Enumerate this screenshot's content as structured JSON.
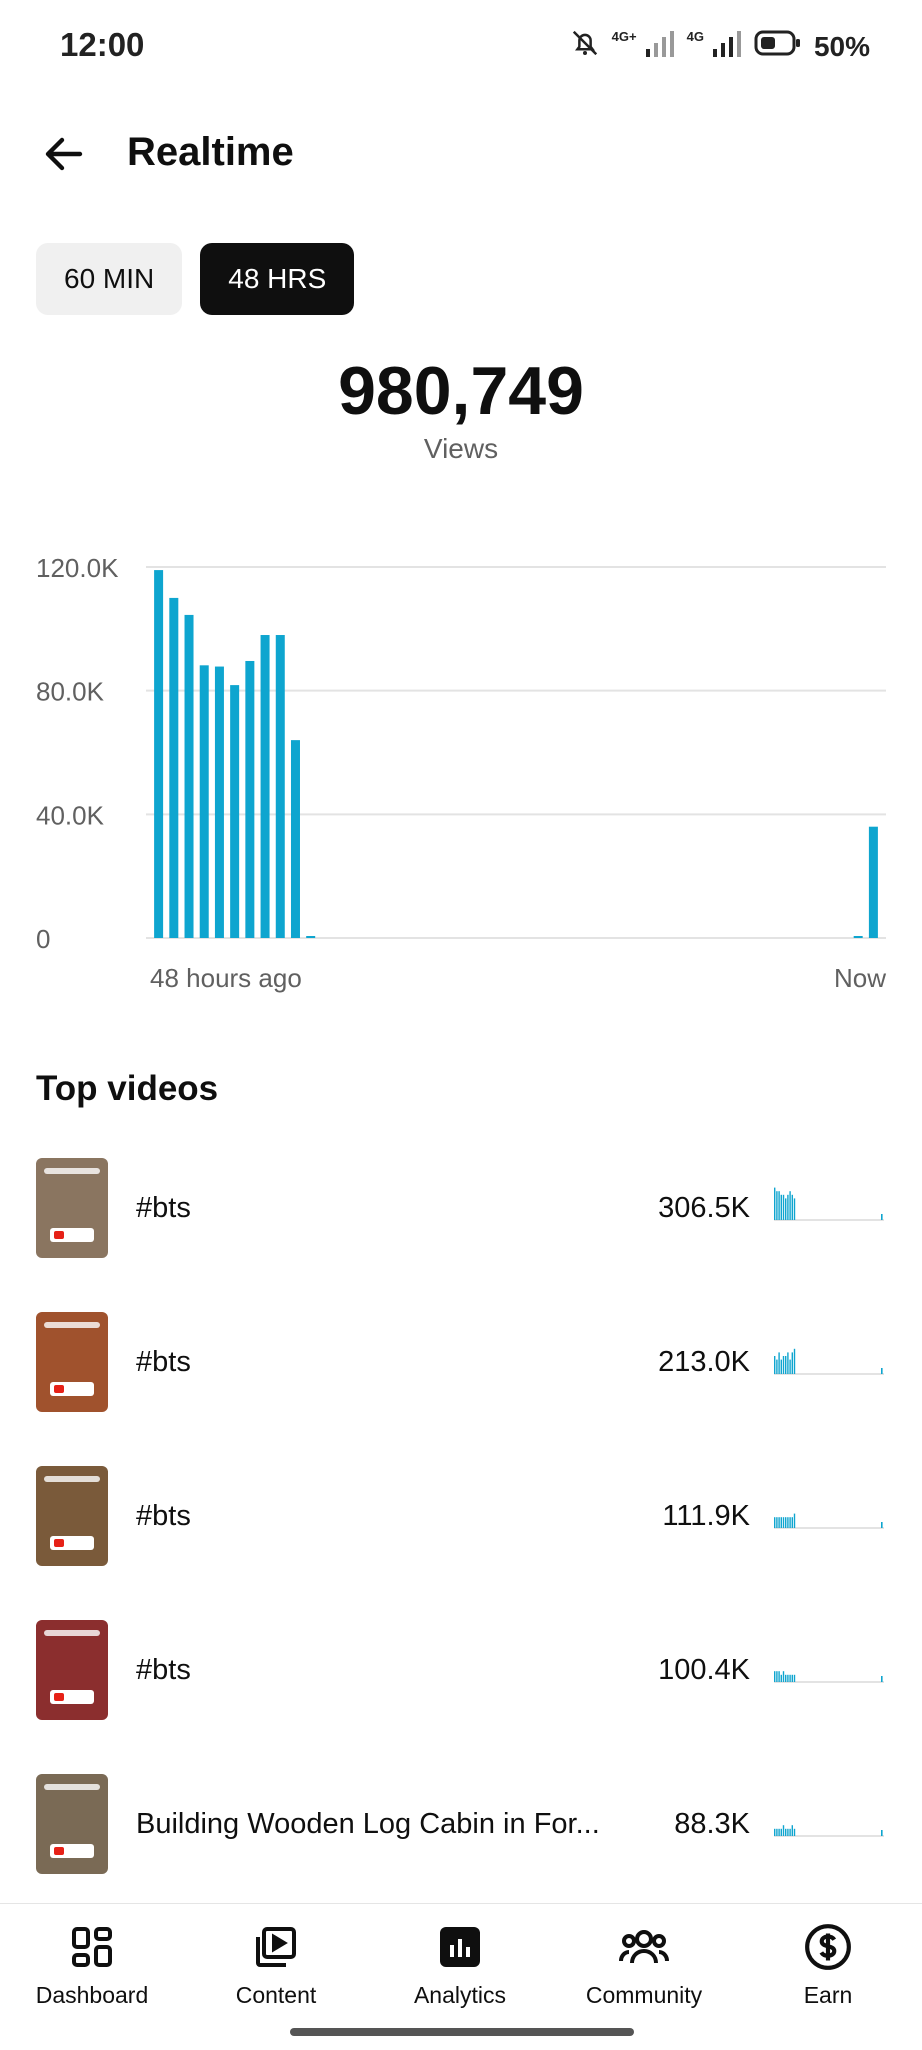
{
  "status": {
    "time": "12:00",
    "net1": "4G+",
    "net2": "4G",
    "battery": "50%"
  },
  "header": {
    "title": "Realtime"
  },
  "tabs": [
    {
      "label": "60 MIN",
      "active": false
    },
    {
      "label": "48 HRS",
      "active": true
    }
  ],
  "summary": {
    "views": "980,749",
    "label": "Views"
  },
  "chart_data": {
    "type": "bar",
    "title": "",
    "xlabel": "",
    "ylabel": "",
    "x_tick_labels": [
      "48 hours ago",
      "Now"
    ],
    "y_tick_labels": [
      "0",
      "40.0K",
      "80.0K",
      "120.0K"
    ],
    "ylim": [
      0,
      120000
    ],
    "grid": true,
    "color": "#0ea5cf",
    "values": [
      119000,
      110000,
      104500,
      88200,
      87800,
      81800,
      89600,
      98000,
      98000,
      64000,
      400,
      0,
      0,
      0,
      0,
      0,
      0,
      0,
      0,
      0,
      0,
      0,
      0,
      0,
      0,
      0,
      0,
      0,
      0,
      0,
      0,
      0,
      0,
      0,
      0,
      0,
      0,
      0,
      0,
      0,
      0,
      0,
      0,
      0,
      0,
      0,
      400,
      36000
    ]
  },
  "top_videos": {
    "title": "Top videos",
    "items": [
      {
        "title": "#bts",
        "views": "306.5K",
        "thumb_color": "#8a7560",
        "spark": [
          9,
          8,
          8,
          7,
          7,
          6,
          7,
          8,
          7,
          6
        ]
      },
      {
        "title": "#bts",
        "views": "213.0K",
        "thumb_color": "#a0522d",
        "spark": [
          5,
          4,
          6,
          4,
          5,
          5,
          6,
          4,
          6,
          7
        ]
      },
      {
        "title": "#bts",
        "views": "111.9K",
        "thumb_color": "#7a5a3a",
        "spark": [
          3,
          3,
          3,
          3,
          3,
          3,
          3,
          3,
          3,
          4
        ]
      },
      {
        "title": "#bts",
        "views": "100.4K",
        "thumb_color": "#8b2e2e",
        "spark": [
          3,
          3,
          3,
          2,
          3,
          2,
          2,
          2,
          2,
          2
        ]
      },
      {
        "title": "Building Wooden Log Cabin in For...",
        "views": "88.3K",
        "thumb_color": "#7a6a55",
        "spark": [
          2,
          2,
          2,
          2,
          3,
          2,
          2,
          2,
          3,
          2
        ]
      }
    ]
  },
  "nav": [
    {
      "label": "Dashboard",
      "icon": "dashboard-icon"
    },
    {
      "label": "Content",
      "icon": "content-icon"
    },
    {
      "label": "Analytics",
      "icon": "analytics-icon"
    },
    {
      "label": "Community",
      "icon": "community-icon"
    },
    {
      "label": "Earn",
      "icon": "earn-icon"
    }
  ]
}
